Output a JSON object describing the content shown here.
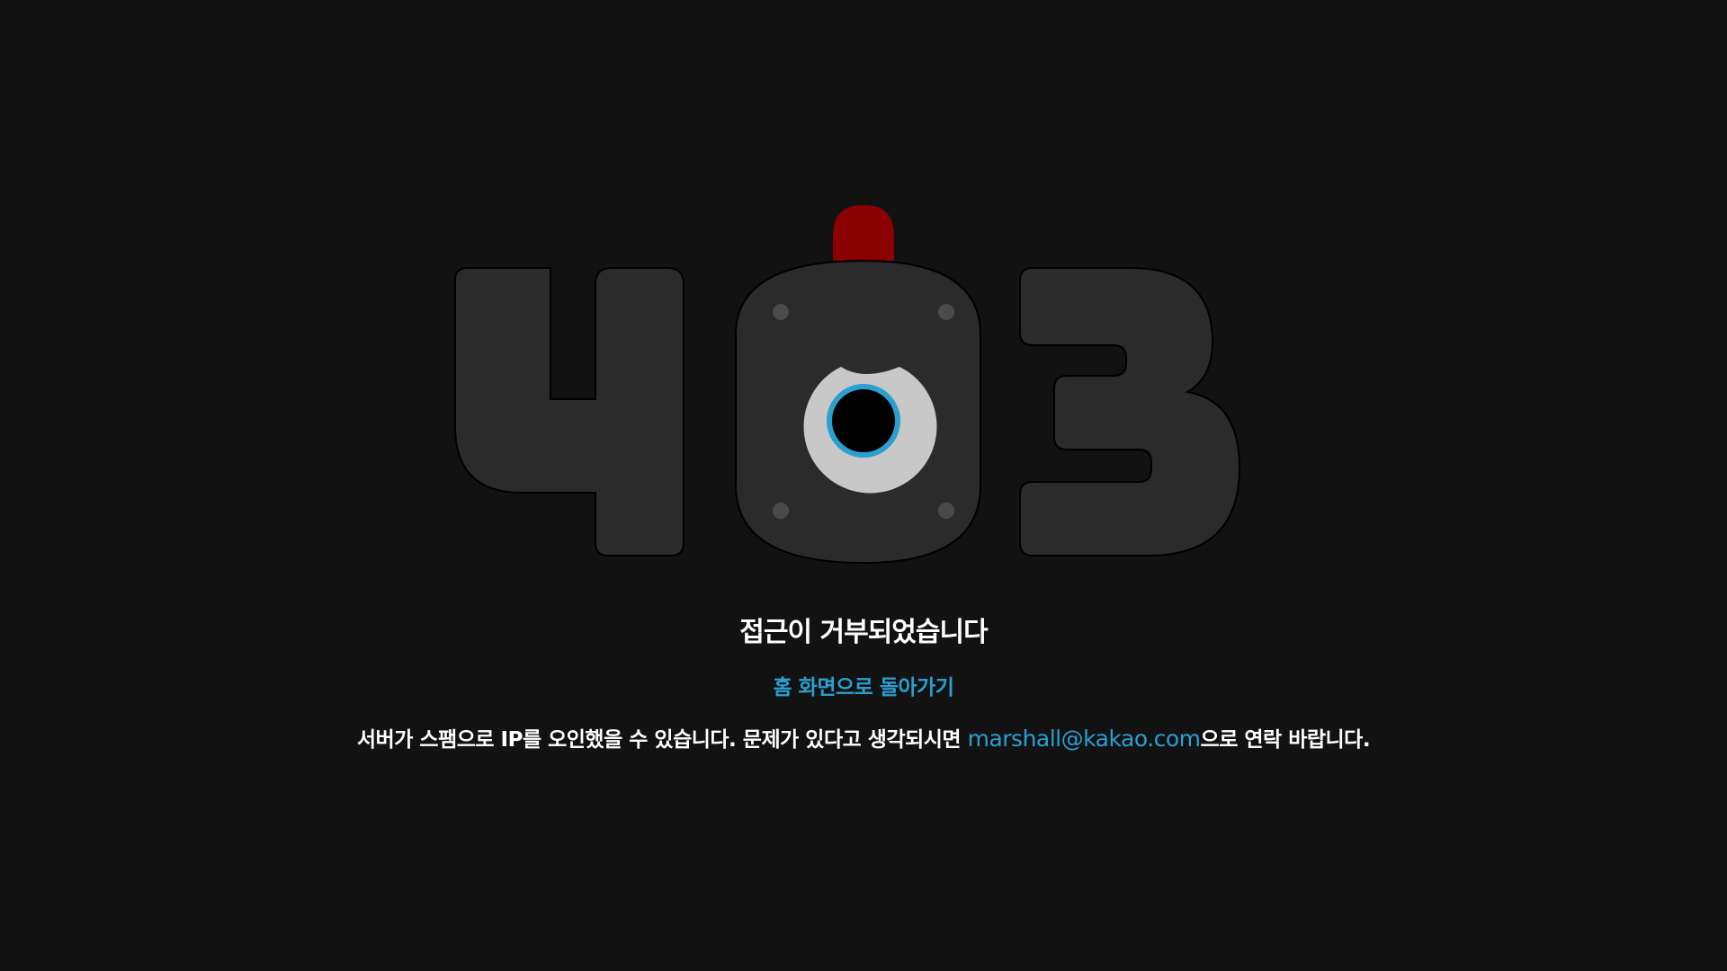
{
  "error_code": {
    "digits": [
      "4",
      "0",
      "3"
    ],
    "body_color": "#2b2b2b",
    "light_color": "#8b0000",
    "eye_ring_color": "#2a9fd0",
    "eye_white_color": "#c8c8c8"
  },
  "heading": "접근이 거부되었습니다",
  "home_link_label": "홈 화면으로 돌아가기",
  "notice": {
    "before_email": "서버가 스팸으로 IP를 오인했을 수 있습니다. 문제가 있다고 생각되시면 ",
    "email": "marshall@kakao.com",
    "after_email": "으로 연락 바랍니다."
  },
  "colors": {
    "background": "#121212",
    "text": "#ffffff",
    "link": "#2a9fd0"
  }
}
